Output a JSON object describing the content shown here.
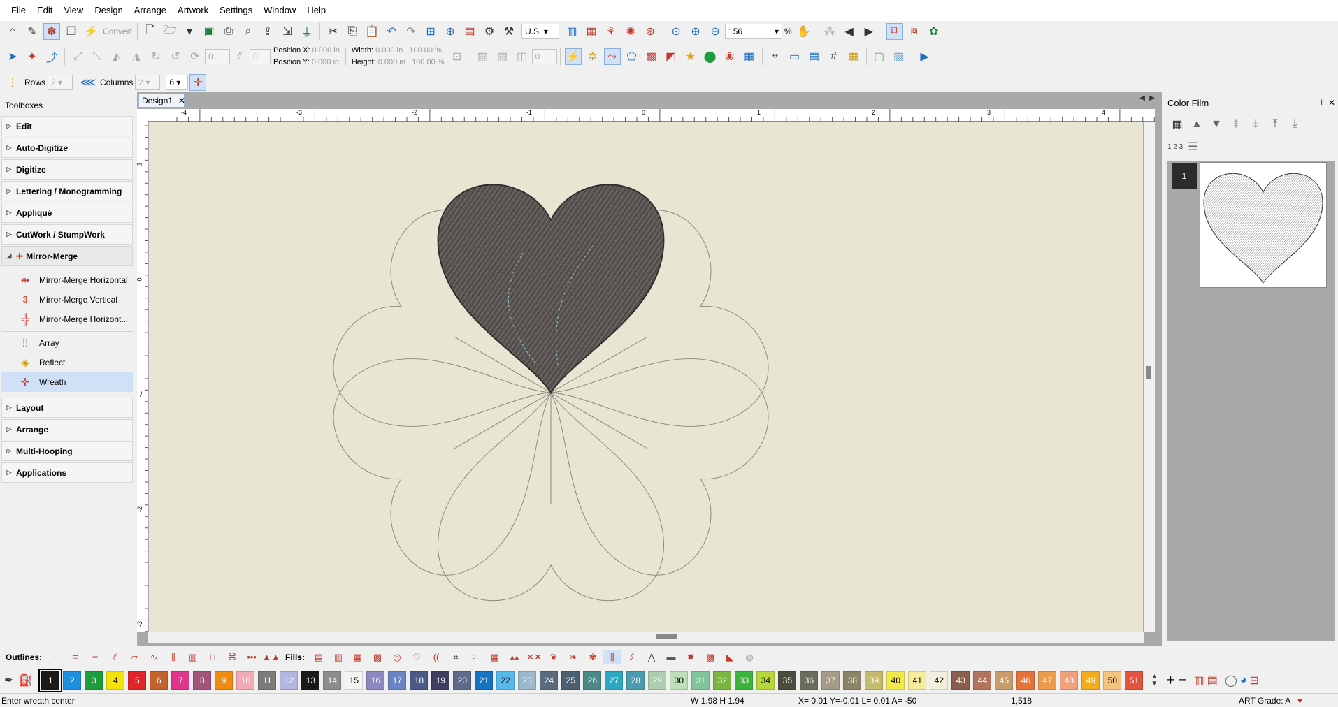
{
  "menu": [
    "File",
    "Edit",
    "View",
    "Design",
    "Arrange",
    "Artwork",
    "Settings",
    "Window",
    "Help"
  ],
  "toolbar1": {
    "convert_label": "Convert",
    "units_value": "U.S.",
    "zoom_value": "156",
    "zoom_unit": "%"
  },
  "toolbar2": {
    "rotate_value": "0",
    "slant_value": "0",
    "position_x_label": "Position X:",
    "position_x_value": "0.000",
    "position_y_label": "Position Y:",
    "position_y_value": "0.000",
    "width_label": "Width:",
    "width_value": "0.000",
    "height_label": "Height:",
    "height_value": "0.000",
    "unit": "in",
    "width_pct": "100.00",
    "height_pct": "100.00",
    "pct": "%",
    "stitch_count": "0"
  },
  "toolbar3": {
    "rows_label": "Rows",
    "rows_value": "2",
    "columns_label": "Columns",
    "columns_value": "2",
    "count_value": "6"
  },
  "toolboxes": {
    "title": "Toolboxes",
    "groups": [
      "Edit",
      "Auto-Digitize",
      "Digitize",
      "Lettering / Monogramming",
      "Appliqué",
      "CutWork / StumpWork",
      "Mirror-Merge"
    ],
    "mirror_items": [
      "Mirror-Merge Horizontal",
      "Mirror-Merge Vertical",
      "Mirror-Merge Horizont...",
      "Array",
      "Reflect",
      "Wreath"
    ],
    "groups_after": [
      "Layout",
      "Arrange",
      "Multi-Hooping",
      "Applications"
    ]
  },
  "document": {
    "tab_title": "Design1",
    "ruler_h": [
      "-4",
      "-3",
      "-2",
      "-1",
      "0",
      "1",
      "2",
      "3",
      "4"
    ],
    "ruler_v": [
      "1",
      "0",
      "-1",
      "-2",
      "-3"
    ]
  },
  "color_film": {
    "title": "Color Film",
    "number_label": "1 2 3",
    "item_number": "1"
  },
  "bottombar": {
    "outlines_label": "Outlines:",
    "fills_label": "Fills:"
  },
  "palette": [
    {
      "n": "1",
      "c": "#1a1a1a",
      "t": "#ffffff"
    },
    {
      "n": "2",
      "c": "#1f8fe0",
      "t": "#ffffff"
    },
    {
      "n": "3",
      "c": "#1e9d3e",
      "t": "#ffffff"
    },
    {
      "n": "4",
      "c": "#f5e10a",
      "t": "#000000"
    },
    {
      "n": "5",
      "c": "#e02626",
      "t": "#ffffff"
    },
    {
      "n": "6",
      "c": "#c4622d",
      "t": "#ffffff"
    },
    {
      "n": "7",
      "c": "#e0358a",
      "t": "#ffffff"
    },
    {
      "n": "8",
      "c": "#a3547d",
      "t": "#ffffff"
    },
    {
      "n": "9",
      "c": "#f08a10",
      "t": "#ffffff"
    },
    {
      "n": "10",
      "c": "#f2a9b4",
      "t": "#ffffff"
    },
    {
      "n": "11",
      "c": "#7b7b7b",
      "t": "#ffffff"
    },
    {
      "n": "12",
      "c": "#b4b4e0",
      "t": "#ffffff"
    },
    {
      "n": "13",
      "c": "#1a1a1a",
      "t": "#ffffff"
    },
    {
      "n": "14",
      "c": "#8c8c8c",
      "t": "#ffffff"
    },
    {
      "n": "15",
      "c": "#f4f4f4",
      "t": "#000000"
    },
    {
      "n": "16",
      "c": "#8a8ac0",
      "t": "#ffffff"
    },
    {
      "n": "17",
      "c": "#6c84c4",
      "t": "#ffffff"
    },
    {
      "n": "18",
      "c": "#4a5a86",
      "t": "#ffffff"
    },
    {
      "n": "19",
      "c": "#3e3e62",
      "t": "#ffffff"
    },
    {
      "n": "20",
      "c": "#5e6c8c",
      "t": "#ffffff"
    },
    {
      "n": "21",
      "c": "#1673c4",
      "t": "#ffffff"
    },
    {
      "n": "22",
      "c": "#56b8ec",
      "t": "#000000"
    },
    {
      "n": "23",
      "c": "#9cb8cc",
      "t": "#ffffff"
    },
    {
      "n": "24",
      "c": "#5a6c7c",
      "t": "#ffffff"
    },
    {
      "n": "25",
      "c": "#4c6072",
      "t": "#ffffff"
    },
    {
      "n": "26",
      "c": "#4c8a8a",
      "t": "#ffffff"
    },
    {
      "n": "27",
      "c": "#2ca8c4",
      "t": "#ffffff"
    },
    {
      "n": "28",
      "c": "#4c9ab0",
      "t": "#ffffff"
    },
    {
      "n": "29",
      "c": "#aeccae",
      "t": "#ffffff"
    },
    {
      "n": "30",
      "c": "#bce0b8",
      "t": "#000000"
    },
    {
      "n": "31",
      "c": "#82c49c",
      "t": "#ffffff"
    },
    {
      "n": "32",
      "c": "#7cb442",
      "t": "#ffffff"
    },
    {
      "n": "33",
      "c": "#3cb43c",
      "t": "#ffffff"
    },
    {
      "n": "34",
      "c": "#b8d63c",
      "t": "#000000"
    },
    {
      "n": "35",
      "c": "#4c4c3c",
      "t": "#ffffff"
    },
    {
      "n": "36",
      "c": "#6c6c5c",
      "t": "#ffffff"
    },
    {
      "n": "37",
      "c": "#a49c84",
      "t": "#ffffff"
    },
    {
      "n": "38",
      "c": "#8c8468",
      "t": "#ffffff"
    },
    {
      "n": "39",
      "c": "#c4bc6c",
      "t": "#ffffff"
    },
    {
      "n": "40",
      "c": "#f4e84c",
      "t": "#000000"
    },
    {
      "n": "41",
      "c": "#f6ec9c",
      "t": "#000000"
    },
    {
      "n": "42",
      "c": "#f4f0dc",
      "t": "#000000"
    },
    {
      "n": "43",
      "c": "#8c5c4c",
      "t": "#ffffff"
    },
    {
      "n": "44",
      "c": "#b4745c",
      "t": "#ffffff"
    },
    {
      "n": "45",
      "c": "#c89c6c",
      "t": "#ffffff"
    },
    {
      "n": "46",
      "c": "#e4743c",
      "t": "#ffffff"
    },
    {
      "n": "47",
      "c": "#ec9c4c",
      "t": "#ffffff"
    },
    {
      "n": "48",
      "c": "#f0a07c",
      "t": "#ffffff"
    },
    {
      "n": "49",
      "c": "#f4ac1c",
      "t": "#ffffff"
    },
    {
      "n": "50",
      "c": "#f4c47c",
      "t": "#000000"
    },
    {
      "n": "51",
      "c": "#e4543c",
      "t": "#ffffff"
    }
  ],
  "status": {
    "message": "Enter wreath center",
    "size": "W 1.98 H 1.94",
    "coords": "X= 0.01 Y=-0.01 L= 0.01 A= -50",
    "stitches": "1,518",
    "grade": "ART Grade: A"
  },
  "colors": {
    "canvas": "#e8e5d2",
    "heart_fill": "#5a5553",
    "selection": "#cfe0f7",
    "accent_red": "#c0392b"
  }
}
